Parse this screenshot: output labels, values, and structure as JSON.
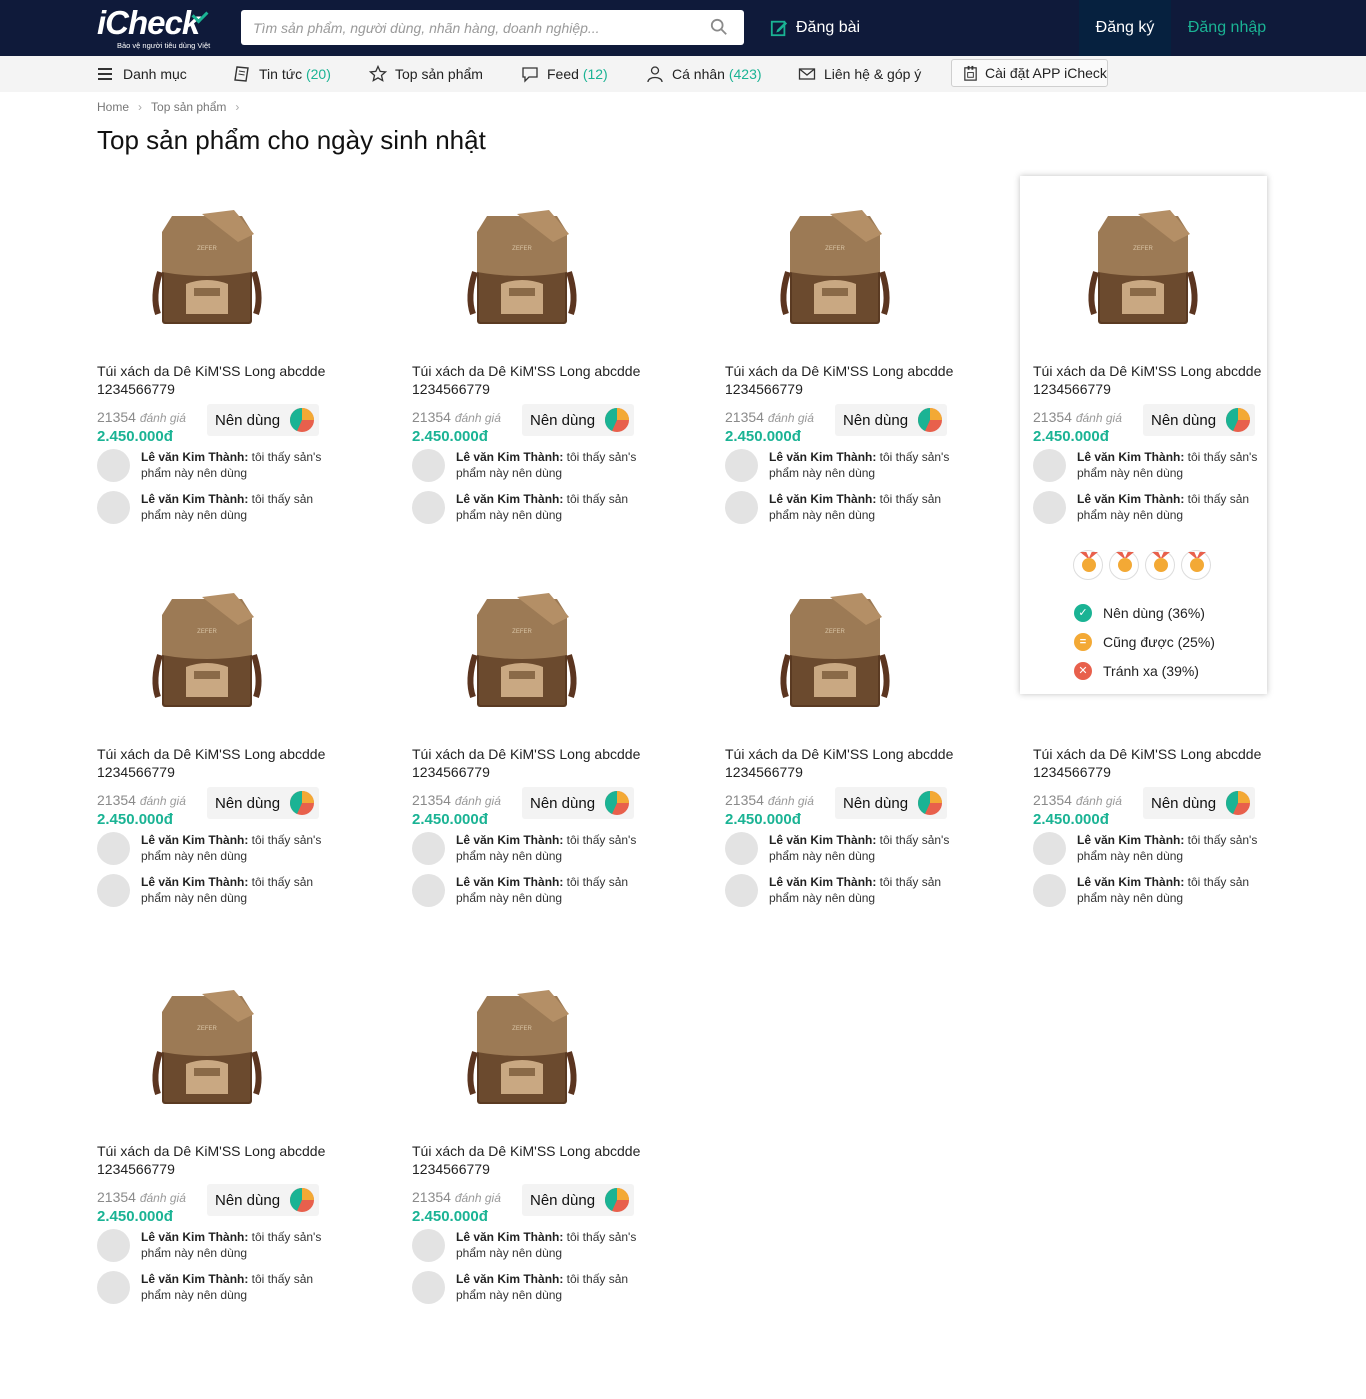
{
  "header": {
    "logo_text": "iCheck",
    "logo_tagline": "Bảo vệ người tiêu dùng Việt",
    "search_placeholder": "Tìm sản phẩm, người dùng, nhãn hàng, doanh nghiệp...",
    "post_label": "Đăng bài",
    "register_label": "Đăng ký",
    "login_label": "Đăng nhập"
  },
  "nav": {
    "category": "Danh mục",
    "news": "Tin tức",
    "news_count": "(20)",
    "top_products": "Top sản phẩm",
    "feed": "Feed",
    "feed_count": "(12)",
    "personal": "Cá nhân",
    "personal_count": "(423)",
    "contact": "Liên hệ & góp ý",
    "install_app": "Cài đặt APP iCheck"
  },
  "breadcrumb": {
    "home": "Home",
    "current": "Top sản phẩm"
  },
  "page_title": "Top sản phẩm cho ngày sinh nhật",
  "colors": {
    "primary_dark": "#0f1a3a",
    "accent": "#1ab394",
    "register_bg": "#06213f",
    "pie_green": "#1ab394",
    "pie_orange": "#f3a935",
    "pie_red": "#e8604c"
  },
  "products": [
    {
      "name": "Túi xách da Dê KiM'SS Long abcdde 1234566779",
      "count": "21354",
      "count_label": "đánh giá",
      "price": "2.450.000đ",
      "badge": "Nên dùng",
      "reviews": [
        {
          "user": "Lê văn Kim Thành:",
          "text": " tôi thấy sản's phẩm này nên dùng"
        },
        {
          "user": "Lê văn Kim Thành:",
          "text": " tôi thấy sản phẩm này nên dùng"
        }
      ]
    },
    {
      "name": "Túi xách da Dê KiM'SS Long abcdde 1234566779",
      "count": "21354",
      "count_label": "đánh giá",
      "price": "2.450.000đ",
      "badge": "Nên dùng",
      "reviews": [
        {
          "user": "Lê văn Kim Thành:",
          "text": " tôi thấy sản's phẩm này nên dùng"
        },
        {
          "user": "Lê văn Kim Thành:",
          "text": " tôi thấy sản phẩm này nên dùng"
        }
      ]
    },
    {
      "name": "Túi xách da Dê KiM'SS Long abcdde 1234566779",
      "count": "21354",
      "count_label": "đánh giá",
      "price": "2.450.000đ",
      "badge": "Nên dùng",
      "reviews": [
        {
          "user": "Lê văn Kim Thành:",
          "text": " tôi thấy sản's phẩm này nên dùng"
        },
        {
          "user": "Lê văn Kim Thành:",
          "text": " tôi thấy sản phẩm này nên dùng"
        }
      ]
    },
    {
      "name": "Túi xách da Dê KiM'SS Long abcdde 1234566779",
      "count": "21354",
      "count_label": "đánh giá",
      "price": "2.450.000đ",
      "badge": "Nên dùng",
      "reviews": [
        {
          "user": "Lê văn Kim Thành:",
          "text": " tôi thấy sản's phẩm này nên dùng"
        },
        {
          "user": "Lê văn Kim Thành:",
          "text": " tôi thấy sản phẩm này nên dùng"
        }
      ]
    },
    {
      "name": "Túi xách da Dê KiM'SS Long abcdde 1234566779",
      "count": "21354",
      "count_label": "đánh giá",
      "price": "2.450.000đ",
      "badge": "Nên dùng",
      "reviews": [
        {
          "user": "Lê văn Kim Thành:",
          "text": " tôi thấy sản's phẩm này nên dùng"
        },
        {
          "user": "Lê văn Kim Thành:",
          "text": " tôi thấy sản phẩm này nên dùng"
        }
      ]
    },
    {
      "name": "Túi xách da Dê KiM'SS Long abcdde 1234566779",
      "count": "21354",
      "count_label": "đánh giá",
      "price": "2.450.000đ",
      "badge": "Nên dùng",
      "reviews": [
        {
          "user": "Lê văn Kim Thành:",
          "text": " tôi thấy sản's phẩm này nên dùng"
        },
        {
          "user": "Lê văn Kim Thành:",
          "text": " tôi thấy sản phẩm này nên dùng"
        }
      ]
    },
    {
      "name": "Túi xách da Dê KiM'SS Long abcdde 1234566779",
      "count": "21354",
      "count_label": "đánh giá",
      "price": "2.450.000đ",
      "badge": "Nên dùng",
      "reviews": [
        {
          "user": "Lê văn Kim Thành:",
          "text": " tôi thấy sản's phẩm này nên dùng"
        },
        {
          "user": "Lê văn Kim Thành:",
          "text": " tôi thấy sản phẩm này nên dùng"
        }
      ]
    },
    {
      "name": "Túi xách da Dê KiM'SS Long abcdde 1234566779",
      "count": "21354",
      "count_label": "đánh giá",
      "price": "2.450.000đ",
      "badge": "Nên dùng",
      "reviews": [
        {
          "user": "Lê văn Kim Thành:",
          "text": " tôi thấy sản's phẩm này nên dùng"
        },
        {
          "user": "Lê văn Kim Thành:",
          "text": " tôi thấy sản phẩm này nên dùng"
        }
      ]
    },
    {
      "name": "Túi xách da Dê KiM'SS Long abcdde 1234566779",
      "count": "21354",
      "count_label": "đánh giá",
      "price": "2.450.000đ",
      "badge": "Nên dùng",
      "reviews": [
        {
          "user": "Lê văn Kim Thành:",
          "text": " tôi thấy sản's phẩm này nên dùng"
        },
        {
          "user": "Lê văn Kim Thành:",
          "text": " tôi thấy sản phẩm này nên dùng"
        }
      ]
    },
    {
      "name": "Túi xách da Dê KiM'SS Long abcdde 1234566779",
      "count": "21354",
      "count_label": "đánh giá",
      "price": "2.450.000đ",
      "badge": "Nên dùng",
      "reviews": [
        {
          "user": "Lê văn Kim Thành:",
          "text": " tôi thấy sản's phẩm này nên dùng"
        },
        {
          "user": "Lê văn Kim Thành:",
          "text": " tôi thấy sản phẩm này nên dùng"
        }
      ]
    }
  ],
  "popup": {
    "medal_icon": "medal-icon",
    "stats": [
      {
        "label": "Nên dùng (36%)",
        "icon": "check-icon",
        "color": "#1ab394"
      },
      {
        "label": "Cũng được (25%)",
        "icon": "equal-icon",
        "color": "#f3a935"
      },
      {
        "label": "Tránh xa (39%)",
        "icon": "close-icon",
        "color": "#e8604c"
      }
    ]
  }
}
